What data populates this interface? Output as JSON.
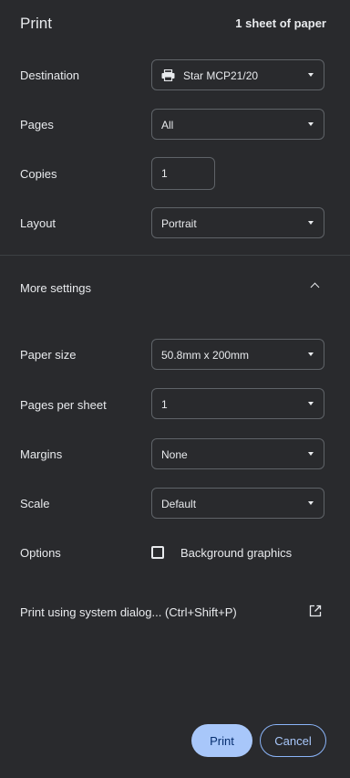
{
  "header": {
    "title": "Print",
    "sheet_count": "1 sheet of paper"
  },
  "destination": {
    "label": "Destination",
    "value": "Star MCP21/20",
    "icon": "printer-icon"
  },
  "pages": {
    "label": "Pages",
    "value": "All"
  },
  "copies": {
    "label": "Copies",
    "value": "1"
  },
  "layout": {
    "label": "Layout",
    "value": "Portrait"
  },
  "more_settings": {
    "label": "More settings",
    "expanded": true,
    "icon": "chevron-up-icon"
  },
  "paper_size": {
    "label": "Paper size",
    "value": "50.8mm x 200mm"
  },
  "pages_per_sheet": {
    "label": "Pages per sheet",
    "value": "1"
  },
  "margins": {
    "label": "Margins",
    "value": "None"
  },
  "scale": {
    "label": "Scale",
    "value": "Default"
  },
  "options": {
    "label": "Options",
    "background_graphics_label": "Background graphics",
    "background_graphics_checked": false
  },
  "system_dialog": {
    "label": "Print using system dialog... (Ctrl+Shift+P)",
    "icon": "open-in-new-icon"
  },
  "buttons": {
    "print": "Print",
    "cancel": "Cancel"
  },
  "colors": {
    "background": "#292a2d",
    "primary": "#a8c7fa",
    "border": "#5f6368"
  }
}
